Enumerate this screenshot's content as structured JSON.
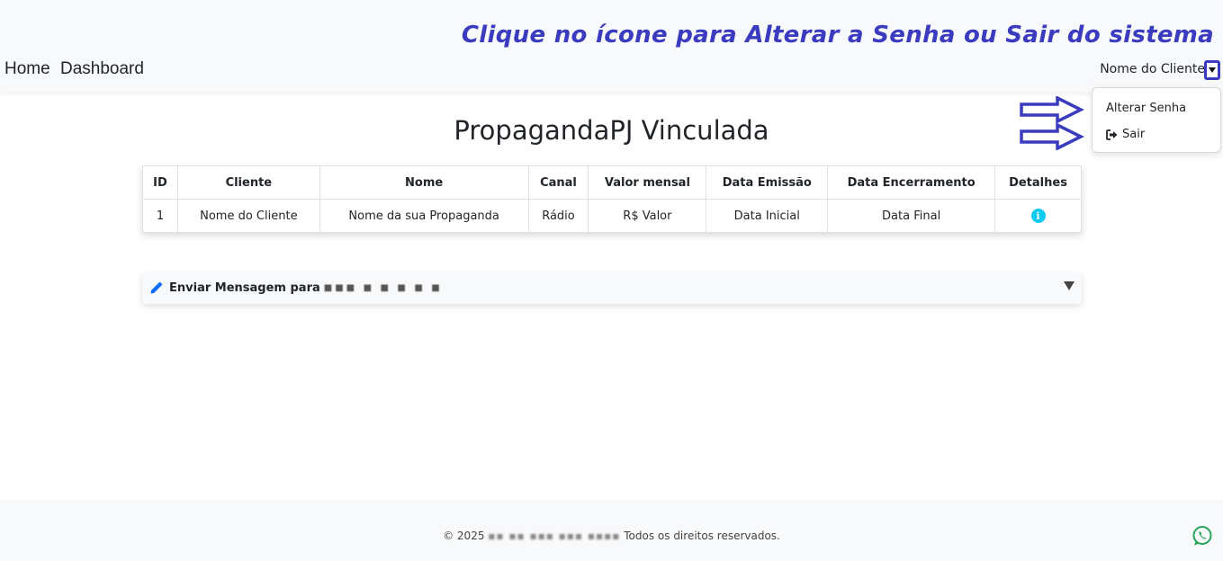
{
  "annotation": "Clique no ícone para Alterar a Senha ou Sair do sistema",
  "nav": {
    "home": "Home",
    "dashboard": "Dashboard",
    "user_name": "Nome do Cliente"
  },
  "dropdown": {
    "items": [
      {
        "label": "Alterar Senha"
      },
      {
        "label": "Sair",
        "icon": "sign-out-icon"
      }
    ]
  },
  "page_title": "PropagandaPJ Vinculada",
  "table": {
    "headers": [
      "ID",
      "Cliente",
      "Nome",
      "Canal",
      "Valor mensal",
      "Data Emissão",
      "Data Encerramento",
      "Detalhes"
    ],
    "rows": [
      {
        "id": "1",
        "cliente": "Nome do Cliente",
        "nome": "Nome da sua Propaganda",
        "canal": "Rádio",
        "valor": "R$ Valor",
        "emissao": "Data Inicial",
        "encerramento": "Data Final",
        "detalhes_icon": "info-icon"
      }
    ]
  },
  "message_panel": {
    "label": "Enviar Mensagem para"
  },
  "footer": {
    "copyright": "© 2025",
    "rights": "Todos os direitos reservados."
  },
  "colors": {
    "annotation": "#3b3bbf",
    "info": "#0dcaf0",
    "whatsapp": "#25a55a",
    "edit_icon": "#0d6efd"
  }
}
